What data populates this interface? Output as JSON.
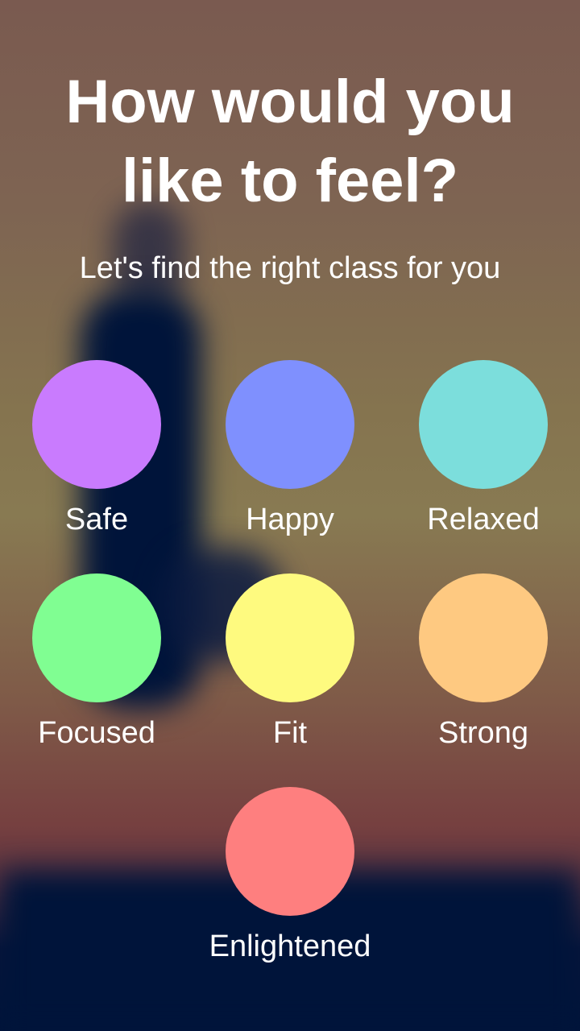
{
  "header": {
    "title_line1": "How would you",
    "title_line2": "like to feel?",
    "subtitle": "Let's find the right class for you"
  },
  "options": [
    {
      "label": "Safe",
      "color": "#c97bfe"
    },
    {
      "label": "Happy",
      "color": "#7f90fe"
    },
    {
      "label": "Relaxed",
      "color": "#7cdedc"
    },
    {
      "label": "Focused",
      "color": "#80fe92"
    },
    {
      "label": "Fit",
      "color": "#fefa7f"
    },
    {
      "label": "Strong",
      "color": "#fec981"
    },
    {
      "label": "Enlightened",
      "color": "#fe7f7f"
    }
  ]
}
